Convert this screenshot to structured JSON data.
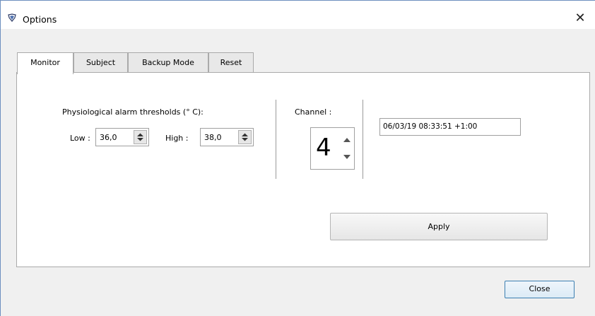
{
  "window": {
    "title": "Options",
    "app_icon": "app-logo-icon",
    "close_glyph": "✕"
  },
  "tabs": [
    {
      "label": "Monitor",
      "active": true
    },
    {
      "label": "Subject",
      "active": false
    },
    {
      "label": "Backup Mode",
      "active": false
    },
    {
      "label": "Reset",
      "active": false
    }
  ],
  "monitor": {
    "thresholds_heading": "Physiological alarm thresholds (° C):",
    "low_label": "Low :",
    "low_value": "36,0",
    "high_label": "High :",
    "high_value": "38,0",
    "channel_label": "Channel :",
    "channel_value": "4",
    "datetime_value": "06/03/19 08:33:51 +1:00",
    "apply_label": "Apply"
  },
  "footer": {
    "close_label": "Close"
  },
  "colors": {
    "accent_border": "#3c7fb1",
    "window_frame": "#6d8fbf",
    "panel_bg": "#ffffff",
    "window_bg": "#f0f0f0"
  }
}
